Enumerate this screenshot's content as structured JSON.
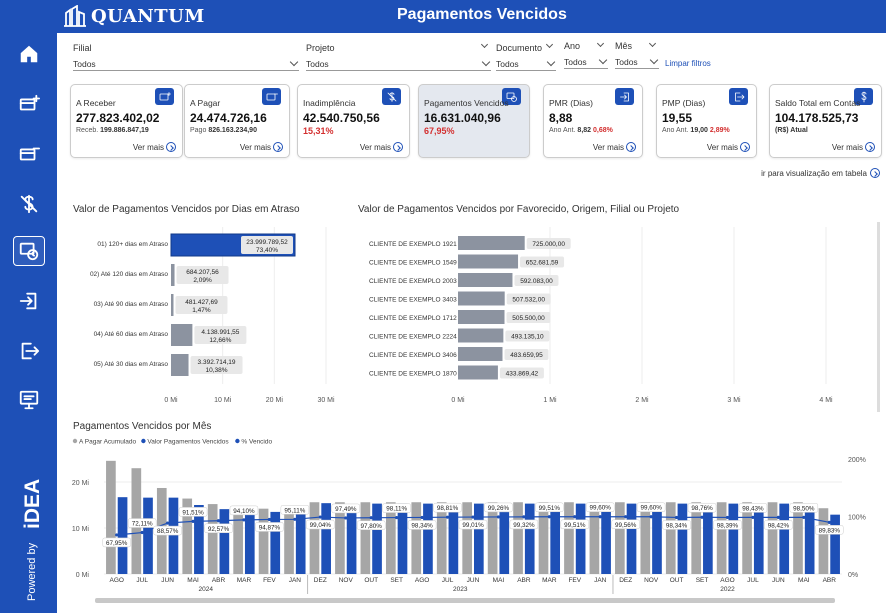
{
  "header": {
    "logo": "QUANTUM",
    "title": "Pagamentos Vencidos"
  },
  "sidebar": {
    "items": [
      {
        "icon": "home-icon"
      },
      {
        "icon": "receivable-icon"
      },
      {
        "icon": "payable-icon"
      },
      {
        "icon": "default-icon"
      },
      {
        "icon": "overdue-payments-icon",
        "active": true
      },
      {
        "icon": "login-icon"
      },
      {
        "icon": "logout-icon"
      },
      {
        "icon": "presentation-icon"
      }
    ],
    "powered_by": "Powered by",
    "brand": "iDEA"
  },
  "filters": {
    "filial": {
      "label": "Filial",
      "value": "Todos"
    },
    "projeto": {
      "label": "Projeto",
      "value": "Todos"
    },
    "documento": {
      "label": "Documento",
      "value": "Todos"
    },
    "ano": {
      "label": "Ano",
      "value": "Todos"
    },
    "mes": {
      "label": "Mês",
      "value": "Todos"
    },
    "clear": "Limpar filtros"
  },
  "cards": [
    {
      "label": "A Receber",
      "value": "277.823.402,02",
      "sub_label": "Receb.",
      "sub_value": "199.886.847,19",
      "more": "Ver mais"
    },
    {
      "label": "A Pagar",
      "value": "24.474.726,16",
      "sub_label": "Pago",
      "sub_value": "826.163.234,90",
      "more": "Ver mais"
    },
    {
      "label": "Inadimplência",
      "value": "42.540.750,56",
      "pct": "15,31%",
      "more": "Ver mais"
    },
    {
      "label": "Pagamentos Vencidos",
      "value": "16.631.040,96",
      "pct": "67,95%",
      "more": "Ver mais"
    },
    {
      "label": "PMR (Dias)",
      "value": "8,88",
      "sub_label": "Ano Ant.",
      "sub_value": "8,82",
      "pct": "0,68%",
      "more": "Ver mais"
    },
    {
      "label": "PMP (Dias)",
      "value": "19,55",
      "sub_label": "Ano Ant.",
      "sub_value": "19,00",
      "pct": "2,89%",
      "more": "Ver mais"
    },
    {
      "label": "Saldo Total em Contas",
      "value": "104.178.525,73",
      "sub_value": "(R$) Atual",
      "more": "Ver mais"
    }
  ],
  "table_link": "ir para visualização em tabela",
  "chart_data": [
    {
      "type": "bar",
      "orientation": "horizontal",
      "title": "Valor de Pagamentos Vencidos por Dias em Atraso",
      "categories": [
        "01) 120+ dias em Atraso",
        "02) Até 120 dias em Atraso",
        "03) Até 90 dias em Atraso",
        "04) Até 60 dias em Atraso",
        "05) Até 30 dias em Atraso"
      ],
      "values": [
        23999789.52,
        684207.56,
        481427.69,
        4138991.55,
        3392714.19
      ],
      "value_labels": [
        "23.999.789,52",
        "684.207,56",
        "481.427,69",
        "4.138.991,55",
        "3.392.714,19"
      ],
      "pct_labels": [
        "73,40%",
        "2,09%",
        "1,47%",
        "12,66%",
        "10,38%"
      ],
      "ticks": [
        "0 Mi",
        "10 Mi",
        "20 Mi",
        "30 Mi"
      ],
      "xlim": [
        0,
        30000000
      ],
      "colors": {
        "first": "#1e50b7",
        "rest": "#8c93a0"
      }
    },
    {
      "type": "bar",
      "orientation": "horizontal",
      "title": "Valor de Pagamentos Vencidos por Favorecido, Origem, Filial ou Projeto",
      "categories": [
        "CLIENTE DE EXEMPLO 1921",
        "CLIENTE DE EXEMPLO 1549",
        "CLIENTE DE EXEMPLO 2003",
        "CLIENTE DE EXEMPLO 3403",
        "CLIENTE DE EXEMPLO 1712",
        "CLIENTE DE EXEMPLO 2224",
        "CLIENTE DE EXEMPLO 3406",
        "CLIENTE DE EXEMPLO 1870"
      ],
      "values": [
        725000.0,
        652681.59,
        592083.0,
        507532.0,
        505500.0,
        493135.1,
        483659.95,
        433869.42
      ],
      "value_labels": [
        "725.000,00",
        "652.681,59",
        "592.083,00",
        "507.532,00",
        "505.500,00",
        "493.135,10",
        "483.659,95",
        "433.869,42"
      ],
      "ticks": [
        "0 Mi",
        "1 Mi",
        "2 Mi",
        "3 Mi",
        "4 Mi"
      ],
      "xlim": [
        0,
        4000000
      ],
      "colors": {
        "bar": "#8c93a0"
      }
    },
    {
      "type": "bar",
      "title": "Pagamentos Vencidos por Mês",
      "legend": [
        "A Pagar Acumulado",
        "Valor Pagamentos Vencidos",
        "% Vencido"
      ],
      "categories": [
        "AGO",
        "JUL",
        "JUN",
        "MAI",
        "ABR",
        "MAR",
        "FEV",
        "JAN",
        "DEZ",
        "NOV",
        "OUT",
        "SET",
        "AGO",
        "JUL",
        "JUN",
        "MAI",
        "ABR",
        "MAR",
        "FEV",
        "JAN",
        "DEZ",
        "NOV",
        "OUT",
        "SET",
        "AGO",
        "JUL",
        "JUN",
        "MAI",
        "ABR"
      ],
      "years": [
        {
          "label": "2024",
          "count": 8
        },
        {
          "label": "2023",
          "count": 12
        },
        {
          "label": "2022",
          "count": 9
        }
      ],
      "series": [
        {
          "name": "A Pagar Acumulado",
          "type": "bar",
          "color": "#a6a6a6",
          "values": [
            24.6,
            23.0,
            18.7,
            16.4,
            15.2,
            14.8,
            14.2,
            13.7,
            15.6,
            15.6,
            15.6,
            15.6,
            15.6,
            15.6,
            15.6,
            15.6,
            15.6,
            15.6,
            15.6,
            15.6,
            15.6,
            15.6,
            15.6,
            15.6,
            15.6,
            15.6,
            15.6,
            15.6,
            14.3
          ]
        },
        {
          "name": "Valor Pagamentos Vencidos",
          "type": "bar",
          "color": "#1e50b7",
          "values": [
            16.7,
            16.6,
            16.6,
            15.0,
            14.1,
            13.9,
            13.5,
            13.0,
            15.4,
            15.2,
            15.3,
            15.3,
            15.3,
            15.3,
            15.3,
            15.3,
            15.3,
            15.3,
            15.3,
            15.3,
            15.3,
            15.3,
            15.3,
            15.3,
            15.3,
            15.3,
            15.3,
            15.3,
            12.9
          ]
        },
        {
          "name": "% Vencido",
          "type": "line",
          "color": "#1e50b7",
          "values": [
            67.95,
            72.11,
            88.57,
            91.51,
            92.57,
            94.1,
            94.87,
            95.11,
            99.04,
            97.49,
            97.8,
            98.11,
            98.34,
            98.81,
            99.01,
            99.26,
            99.32,
            99.51,
            99.51,
            99.6,
            99.56,
            99.6,
            98.34,
            98.76,
            98.39,
            98.43,
            98.42,
            98.5,
            89.83
          ],
          "labels": [
            "67,95%",
            "72,11%",
            "88,57%",
            "91,51%",
            "92,57%",
            "94,10%",
            "94,87%",
            "95,11%",
            "99,04%",
            "97,49%",
            "97,80%",
            "98,11%",
            "98,34%",
            "98,81%",
            "99,01%",
            "99,26%",
            "99,32%",
            "99,51%",
            "99,51%",
            "99,60%",
            "99,56%",
            "99,60%",
            "98,34%",
            "98,76%",
            "98,39%",
            "98,43%",
            "98,42%",
            "98,50%",
            "89,83%"
          ]
        }
      ],
      "y_ticks": [
        "0 Mi",
        "10 Mi",
        "20 Mi"
      ],
      "ylim": [
        0,
        25
      ],
      "y2_ticks": [
        "0%",
        "100%",
        "200%"
      ],
      "y2lim": [
        0,
        200
      ]
    }
  ]
}
